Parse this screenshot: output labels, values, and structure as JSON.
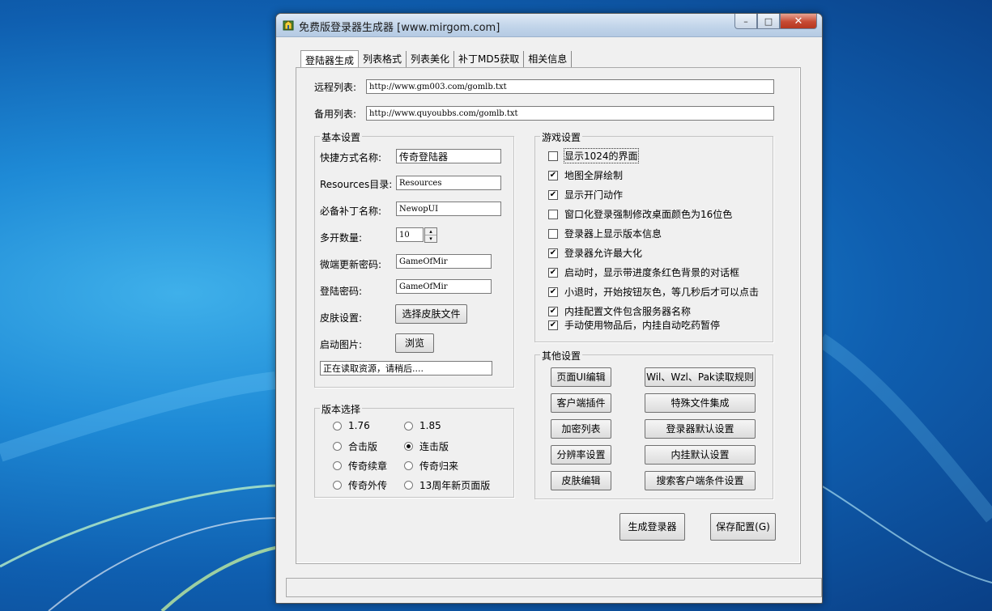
{
  "window": {
    "title": "免费版登录器生成器 [www.mirgom.com]",
    "min_glyph": "–",
    "max_glyph": "□",
    "close_glyph": "✕"
  },
  "tabs": [
    "登陆器生成",
    "列表格式",
    "列表美化",
    "补丁MD5获取",
    "相关信息"
  ],
  "remote_list": {
    "label": "远程列表:",
    "value": "http://www.gm003.com/gomlb.txt"
  },
  "backup_list": {
    "label": "备用列表:",
    "value": "http://www.quyoubbs.com/gomlb.txt"
  },
  "basic": {
    "title": "基本设置",
    "shortcut_label": "快捷方式名称:",
    "shortcut_value": "传奇登陆器",
    "resources_label": "Resources目录:",
    "resources_value": "Resources",
    "patch_label": "必备补丁名称:",
    "patch_value": "NewopUI",
    "multi_label": "多开数量:",
    "multi_value": "10",
    "spin_up": "▴",
    "spin_down": "▾",
    "update_pwd_label": "微端更新密码:",
    "update_pwd_value": "GameOfMir",
    "login_pwd_label": "登陆密码:",
    "login_pwd_value": "GameOfMir",
    "skin_label": "皮肤设置:",
    "skin_button": "选择皮肤文件",
    "splash_label": "启动图片:",
    "browse_button": "浏览",
    "status_text": "正在读取资源，请稍后...."
  },
  "version": {
    "title": "版本选择",
    "options": [
      "1.76",
      "1.85",
      "合击版",
      "连击版",
      "传奇续章",
      "传奇归来",
      "传奇外传",
      "13周年新页面版"
    ],
    "selected": "连击版"
  },
  "game": {
    "title": "游戏设置",
    "items": [
      {
        "label": "显示1024的界面",
        "checked": false
      },
      {
        "label": "地图全屏绘制",
        "checked": true
      },
      {
        "label": "显示开门动作",
        "checked": true
      },
      {
        "label": "窗口化登录强制修改桌面颜色为16位色",
        "checked": false
      },
      {
        "label": "登录器上显示版本信息",
        "checked": false
      },
      {
        "label": "登录器允许最大化",
        "checked": true
      },
      {
        "label": "启动时，显示带进度条红色背景的对话框",
        "checked": true
      },
      {
        "label": "小退时，开始按钮灰色，等几秒后才可以点击",
        "checked": true
      },
      {
        "label": "内挂配置文件包含服务器名称",
        "checked": true
      },
      {
        "label": "手动使用物品后，内挂自动吃药暂停",
        "checked": true
      }
    ]
  },
  "other": {
    "title": "其他设置",
    "ui_edit": "页面UI编辑",
    "rules": "Wil、Wzl、Pak读取规则",
    "plugin": "客户端插件",
    "special_files": "特殊文件集成",
    "encrypt_list": "加密列表",
    "login_default": "登录器默认设置",
    "resolution": "分辨率设置",
    "plugin_default": "内挂默认设置",
    "skin_edit": "皮肤编辑",
    "search_client": "搜索客户端条件设置"
  },
  "actions": {
    "generate": "生成登录器",
    "save": "保存配置(G)"
  }
}
